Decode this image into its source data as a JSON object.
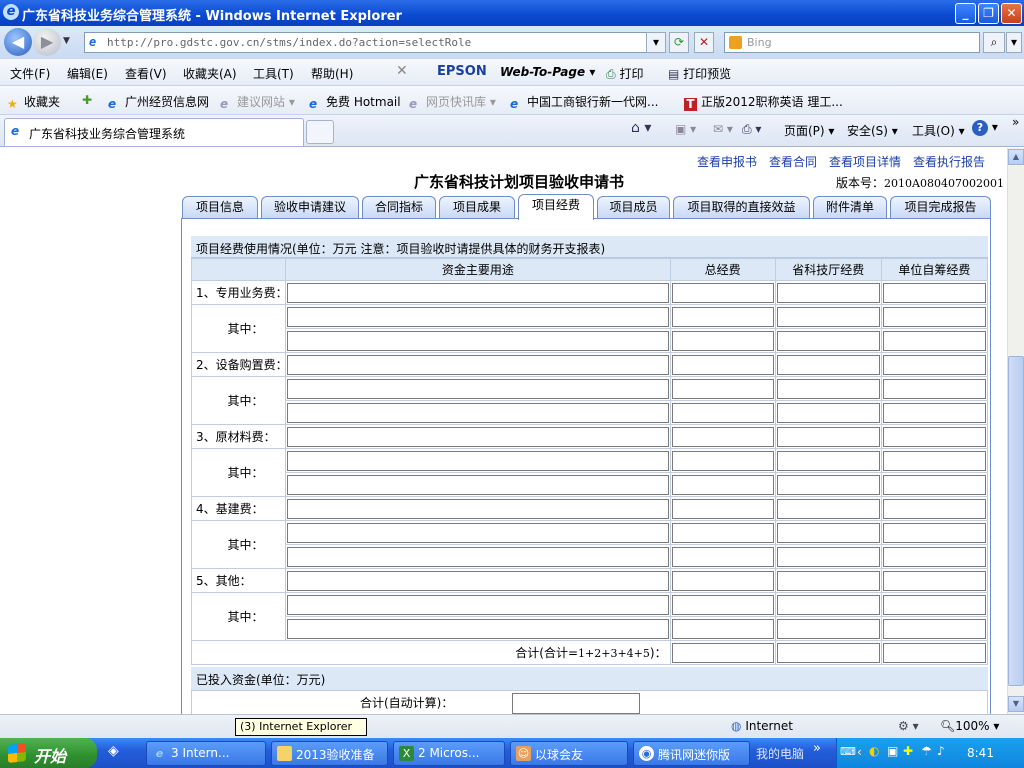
{
  "window": {
    "title": "广东省科技业务综合管理系统 - Windows Internet Explorer"
  },
  "address": {
    "url": "http://pro.gdstc.gov.cn/stms/index.do?action=selectRole",
    "search_placeholder": "Bing"
  },
  "menu": [
    "文件(F)",
    "编辑(E)",
    "查看(V)",
    "收藏夹(A)",
    "工具(T)",
    "帮助(H)"
  ],
  "epson": {
    "brand": "EPSON",
    "web": "Web-To-Page",
    "print": "打印",
    "preview": "打印预览"
  },
  "favorites": {
    "label": "收藏夹",
    "items": [
      "广州经贸信息网",
      "建议网站",
      "免费 Hotmail",
      "网页快讯库",
      "中国工商银行新一代网...",
      "正版2012职称英语 理工..."
    ]
  },
  "browser_tab": {
    "label": "广东省科技业务综合管理系统"
  },
  "commands": {
    "page": "页面(P)",
    "safety": "安全(S)",
    "tools": "工具(O)"
  },
  "page": {
    "links": [
      "查看申报书",
      "查看合同",
      "查看项目详情",
      "查看执行报告"
    ],
    "title": "广东省科技计划项目验收申请书",
    "version_label": "版本号：",
    "version_value": "2010A080407002001",
    "tabs": [
      "项目信息",
      "验收申请建议",
      "合同指标",
      "项目成果",
      "项目经费",
      "项目成员",
      "项目取得的直接效益",
      "附件清单",
      "项目完成报告"
    ],
    "active_tab": "项目经费",
    "section1": {
      "heading": "项目经费使用情况(单位：万元 注意：项目验收时请提供具体的财务开支报表)",
      "columns": [
        "资金主要用途",
        "总经费",
        "省科技厅经费",
        "单位自筹经费"
      ],
      "rows": [
        {
          "label": "1、专用业务费：",
          "sub": "其中："
        },
        {
          "label": "2、设备购置费：",
          "sub": "其中："
        },
        {
          "label": "3、原材料费：",
          "sub": "其中："
        },
        {
          "label": "4、基建费：",
          "sub": "其中："
        },
        {
          "label": "5、其他：",
          "sub": "其中："
        }
      ],
      "total_label": "合计(合计=",
      "total_formula": "1+2+3+4+5",
      "total_suffix": ")："
    },
    "section2": {
      "heading": "已投入资金(单位：万元)",
      "auto_label": "合计(自动计算)："
    }
  },
  "status": {
    "tooltip": "(3) Internet Explorer",
    "zone": "Internet",
    "zoom": "100%"
  },
  "taskbar": {
    "start": "开始",
    "tasks": [
      "3 Intern...",
      "2013验收准备",
      "2 Micros...",
      "以球会友",
      "腾讯网迷你版"
    ],
    "my_computer": "我的电脑",
    "time": "8:41"
  }
}
